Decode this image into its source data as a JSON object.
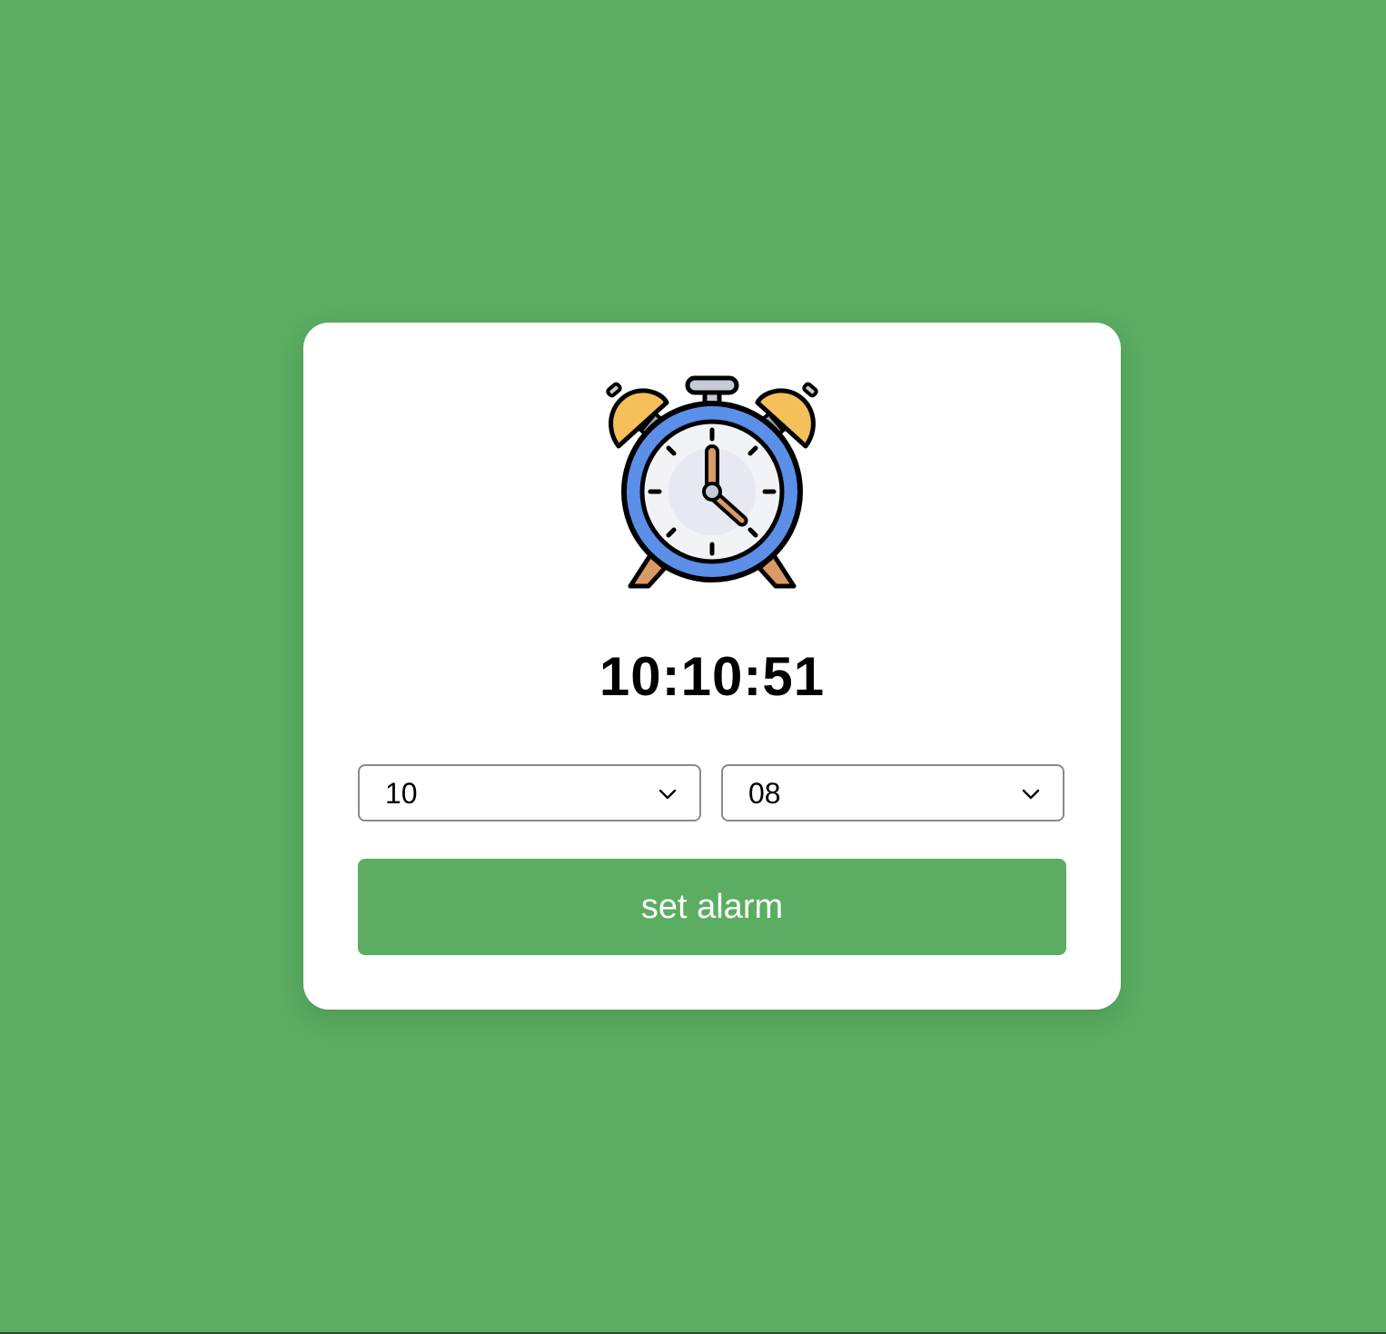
{
  "colors": {
    "background": "#5aad61",
    "card": "#ffffff",
    "button": "#5aad61",
    "button_text": "#ffffff",
    "clock_ring": "#5b8fe8",
    "bells": "#f5c05a",
    "legs": "#d99a66"
  },
  "icon": {
    "name": "alarm-clock-icon"
  },
  "clock": {
    "time": "10:10:51"
  },
  "alarm": {
    "hour": "10",
    "minute": "08",
    "button_label": "set alarm"
  }
}
